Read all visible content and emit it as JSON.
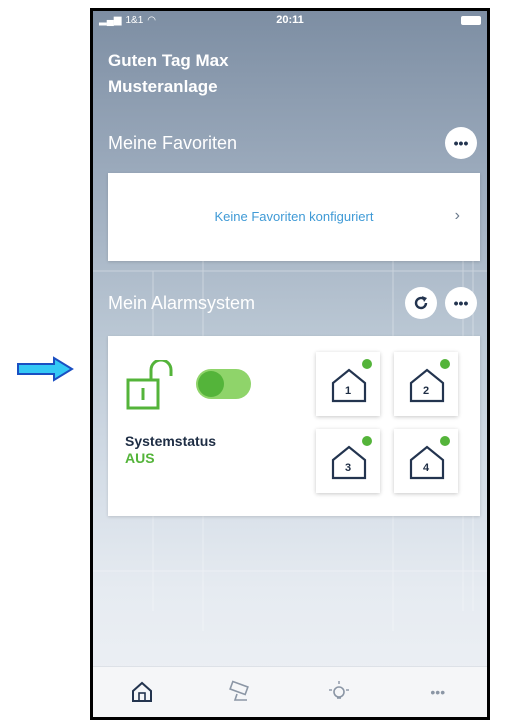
{
  "status_bar": {
    "carrier": "1&1",
    "time": "20:11"
  },
  "greeting": {
    "line1": "Guten Tag Max",
    "line2": "Musteranlage"
  },
  "favorites": {
    "title": "Meine Favoriten",
    "more_icon": "more-dots-icon",
    "empty_text": "Keine Favoriten konfiguriert",
    "chevron": "›"
  },
  "alarm": {
    "title": "Mein Alarmsystem",
    "refresh_icon": "refresh-icon",
    "more_icon": "more-dots-icon",
    "status_label": "Systemstatus",
    "status_value": "AUS",
    "lock_icon": "unlocked-padlock-icon",
    "zones": [
      {
        "number": "1"
      },
      {
        "number": "2"
      },
      {
        "number": "3"
      },
      {
        "number": "4"
      }
    ]
  },
  "tabs": [
    {
      "icon": "home-icon",
      "name": "tab-home"
    },
    {
      "icon": "camera-icon",
      "name": "tab-camera"
    },
    {
      "icon": "bulb-icon",
      "name": "tab-lights"
    },
    {
      "icon": "more-dots-icon",
      "name": "tab-more"
    }
  ],
  "colors": {
    "accent_green": "#54b43a",
    "link_blue": "#3f9ad6",
    "navy": "#23344f",
    "arrow_blue": "#2f8ae6"
  }
}
